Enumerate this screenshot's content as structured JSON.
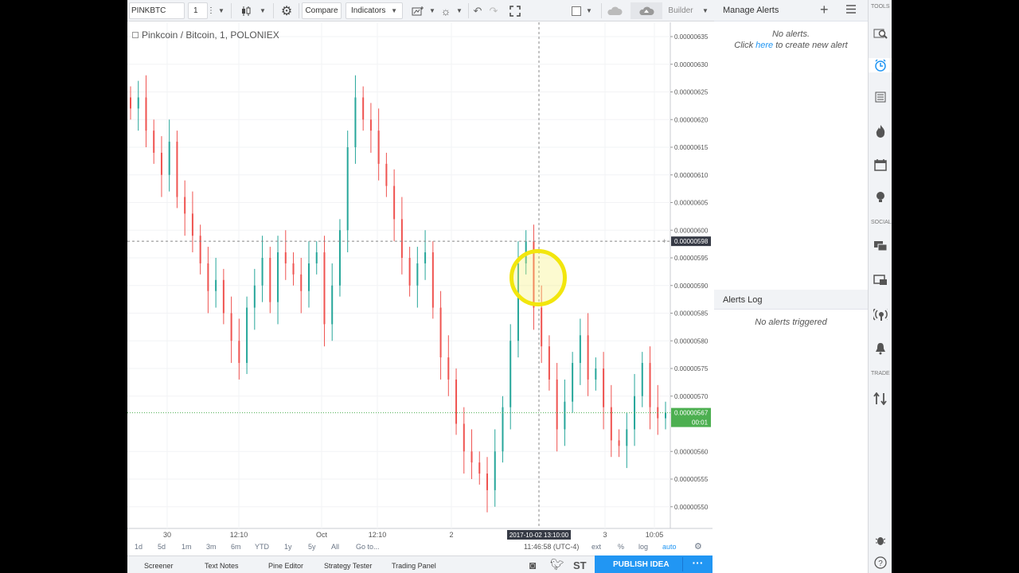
{
  "toolbar": {
    "symbol": "PINKBTC",
    "interval": "1",
    "compare": "Compare",
    "indicators": "Indicators",
    "builder": "Builder"
  },
  "chart": {
    "legend": "Pinkcoin / Bitcoin, 1, POLONIEX",
    "crosshair_price": "0.00000598",
    "last_price": "0.00000567",
    "countdown": "00:01",
    "crosshair_time": "2017-10-02 13:10:00",
    "colors": {
      "up": "#26a69a",
      "down": "#ef5350",
      "last_price": "#4caf50",
      "crosshair_label": "#363a45"
    }
  },
  "chart_data": {
    "type": "candlestick",
    "title": "Pinkcoin / Bitcoin, 1, POLONIEX",
    "x_tick_labels": [
      "30",
      "12:10",
      "Oct",
      "12:10",
      "2",
      "3",
      "10:05"
    ],
    "y_tick_labels": [
      "0.00000635",
      "0.00000630",
      "0.00000625",
      "0.00000620",
      "0.00000615",
      "0.00000610",
      "0.00000605",
      "0.00000600",
      "0.00000595",
      "0.00000590",
      "0.00000585",
      "0.00000580",
      "0.00000575",
      "0.00000570",
      "0.00000560",
      "0.00000555",
      "0.00000550"
    ],
    "ylim": [
      5.45e-06,
      6.37e-06
    ],
    "grid": true,
    "current_price": 5.67e-06,
    "crosshair": {
      "time": "2017-10-02 13:10:00",
      "price": 5.98e-06
    },
    "close_series": [
      6.22e-06,
      6.24e-06,
      6.18e-06,
      6.14e-06,
      6.1e-06,
      6.16e-06,
      6.06e-06,
      6.03e-06,
      5.99e-06,
      5.94e-06,
      5.89e-06,
      5.91e-06,
      5.85e-06,
      5.8e-06,
      5.76e-06,
      5.86e-06,
      5.9e-06,
      5.95e-06,
      5.87e-06,
      5.96e-06,
      5.94e-06,
      5.92e-06,
      5.89e-06,
      5.94e-06,
      5.96e-06,
      5.83e-06,
      5.9e-06,
      6e-06,
      6.15e-06,
      6.24e-06,
      6.2e-06,
      6.18e-06,
      6.12e-06,
      6.08e-06,
      6.02e-06,
      5.95e-06,
      5.9e-06,
      5.94e-06,
      5.96e-06,
      5.86e-06,
      5.77e-06,
      5.73e-06,
      5.65e-06,
      5.6e-06,
      5.58e-06,
      5.56e-06,
      5.53e-06,
      5.6e-06,
      5.68e-06,
      5.8e-06,
      5.94e-06,
      5.98e-06,
      5.86e-06,
      5.79e-06,
      5.73e-06,
      5.64e-06,
      5.69e-06,
      5.76e-06,
      5.81e-06,
      5.73e-06,
      5.75e-06,
      5.68e-06,
      5.62e-06,
      5.61e-06,
      5.64e-06,
      5.7e-06,
      5.76e-06,
      5.68e-06,
      5.66e-06,
      5.67e-06
    ]
  },
  "timeframes": [
    "1d",
    "5d",
    "1m",
    "3m",
    "6m",
    "YTD",
    "1y",
    "5y",
    "All",
    "Go to..."
  ],
  "status": {
    "clock": "11:46:58 (UTC-4)",
    "ext": "ext",
    "percent": "%",
    "log": "log",
    "auto": "auto"
  },
  "bottom_tabs": [
    "Screener",
    "Text Notes",
    "Pine Editor",
    "Strategy Tester",
    "Trading Panel"
  ],
  "publish": "PUBLISH IDEA",
  "st": "ST",
  "alerts": {
    "title": "Manage Alerts",
    "empty": "No alerts.",
    "click": "Click",
    "here": "here",
    "create": "to create new alert",
    "log_title": "Alerts Log",
    "log_empty": "No alerts triggered"
  },
  "sidebar": {
    "tools": "TOOLS",
    "social": "SOCIAL",
    "trade": "TRADE"
  }
}
